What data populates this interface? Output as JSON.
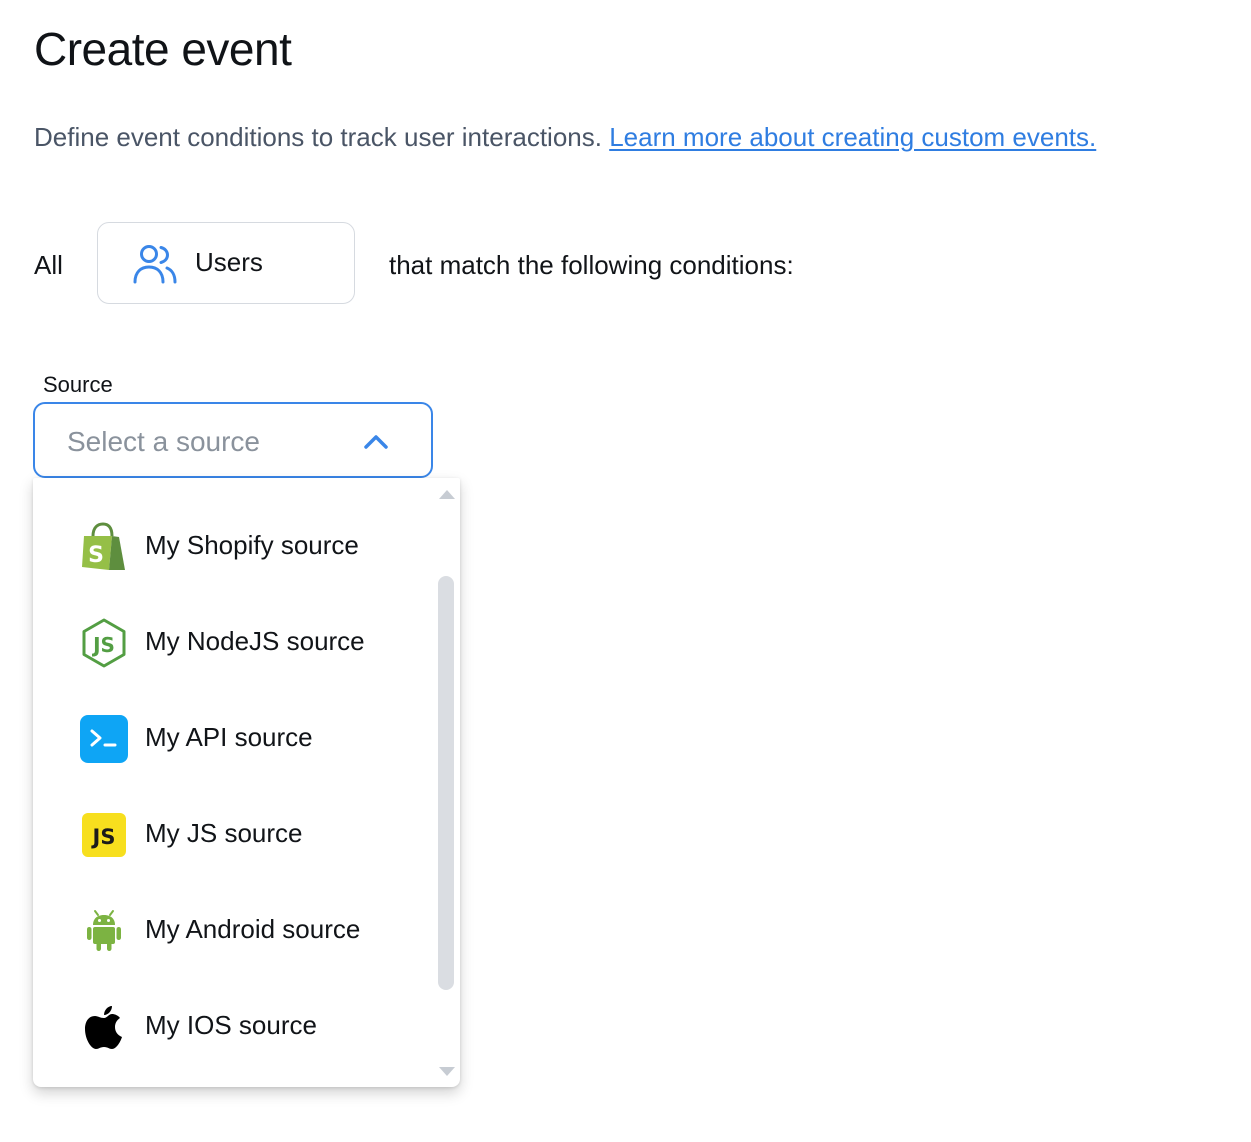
{
  "page": {
    "title": "Create event",
    "description": "Define event conditions to track user interactions.",
    "learn_more_link": "Learn more about creating custom events."
  },
  "condition": {
    "prefix": "All",
    "entity_label": "Users",
    "entity_icon": "users-icon",
    "suffix": "that match the following conditions:"
  },
  "source_field": {
    "label": "Source",
    "placeholder": "Select a source",
    "state": "open"
  },
  "dropdown": {
    "options": [
      {
        "label": "My Shopify source",
        "icon": "shopify-icon"
      },
      {
        "label": "My NodeJS source",
        "icon": "nodejs-icon"
      },
      {
        "label": "My API source",
        "icon": "terminal-icon"
      },
      {
        "label": "My JS source",
        "icon": "javascript-icon"
      },
      {
        "label": "My Android source",
        "icon": "android-icon"
      },
      {
        "label": "My IOS source",
        "icon": "apple-icon"
      }
    ]
  },
  "colors": {
    "accent": "#3a86e8",
    "link": "#2f7de1",
    "shopify": "#95bf47",
    "nodejs": "#539e43",
    "api": "#0ea5f5",
    "javascript": "#f7df1e",
    "android": "#7cb342",
    "apple": "#000000"
  }
}
